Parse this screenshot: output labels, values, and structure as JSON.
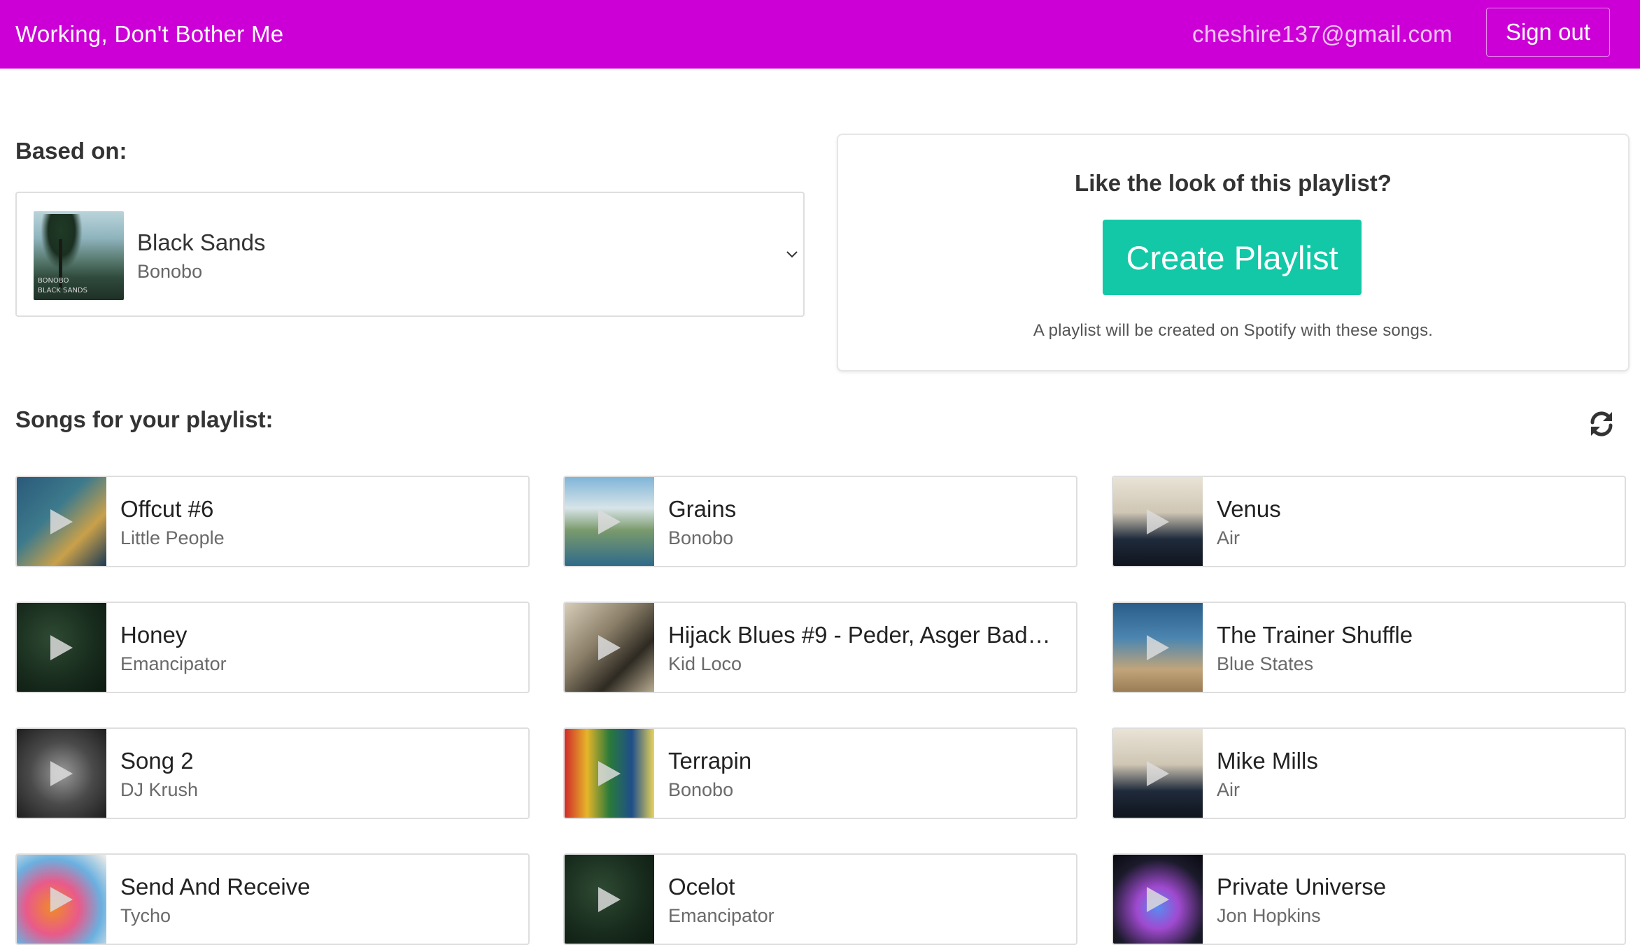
{
  "header": {
    "app_title": "Working, Don't Bother Me",
    "user_email": "cheshire137@gmail.com",
    "sign_out_label": "Sign out",
    "bar_color": "#cc00d6"
  },
  "seed": {
    "label": "Based on:",
    "title": "Black Sands",
    "artist": "Bonobo",
    "cover_caption_1": "BONOBO",
    "cover_caption_2": "BLACK SANDS",
    "icon": "chevron-down-icon"
  },
  "cta": {
    "heading": "Like the look of this playlist?",
    "button_label": "Create Playlist",
    "note": "A playlist will be created on Spotify with these songs.",
    "button_color": "#13c8a7"
  },
  "songs_section": {
    "label": "Songs for your playlist:",
    "refresh_icon": "refresh-icon"
  },
  "songs": [
    {
      "title": "Offcut #6",
      "artist": "Little People"
    },
    {
      "title": "Grains",
      "artist": "Bonobo"
    },
    {
      "title": "Venus",
      "artist": "Air"
    },
    {
      "title": "Honey",
      "artist": "Emancipator"
    },
    {
      "title": "Hijack Blues #9 - Peder, Asger Bad…",
      "artist": "Kid Loco"
    },
    {
      "title": "The Trainer Shuffle",
      "artist": "Blue States"
    },
    {
      "title": "Song 2",
      "artist": "DJ Krush"
    },
    {
      "title": "Terrapin",
      "artist": "Bonobo"
    },
    {
      "title": "Mike Mills",
      "artist": "Air"
    },
    {
      "title": "Send And Receive",
      "artist": "Tycho"
    },
    {
      "title": "Ocelot",
      "artist": "Emancipator"
    },
    {
      "title": "Private Universe",
      "artist": "Jon Hopkins"
    }
  ]
}
